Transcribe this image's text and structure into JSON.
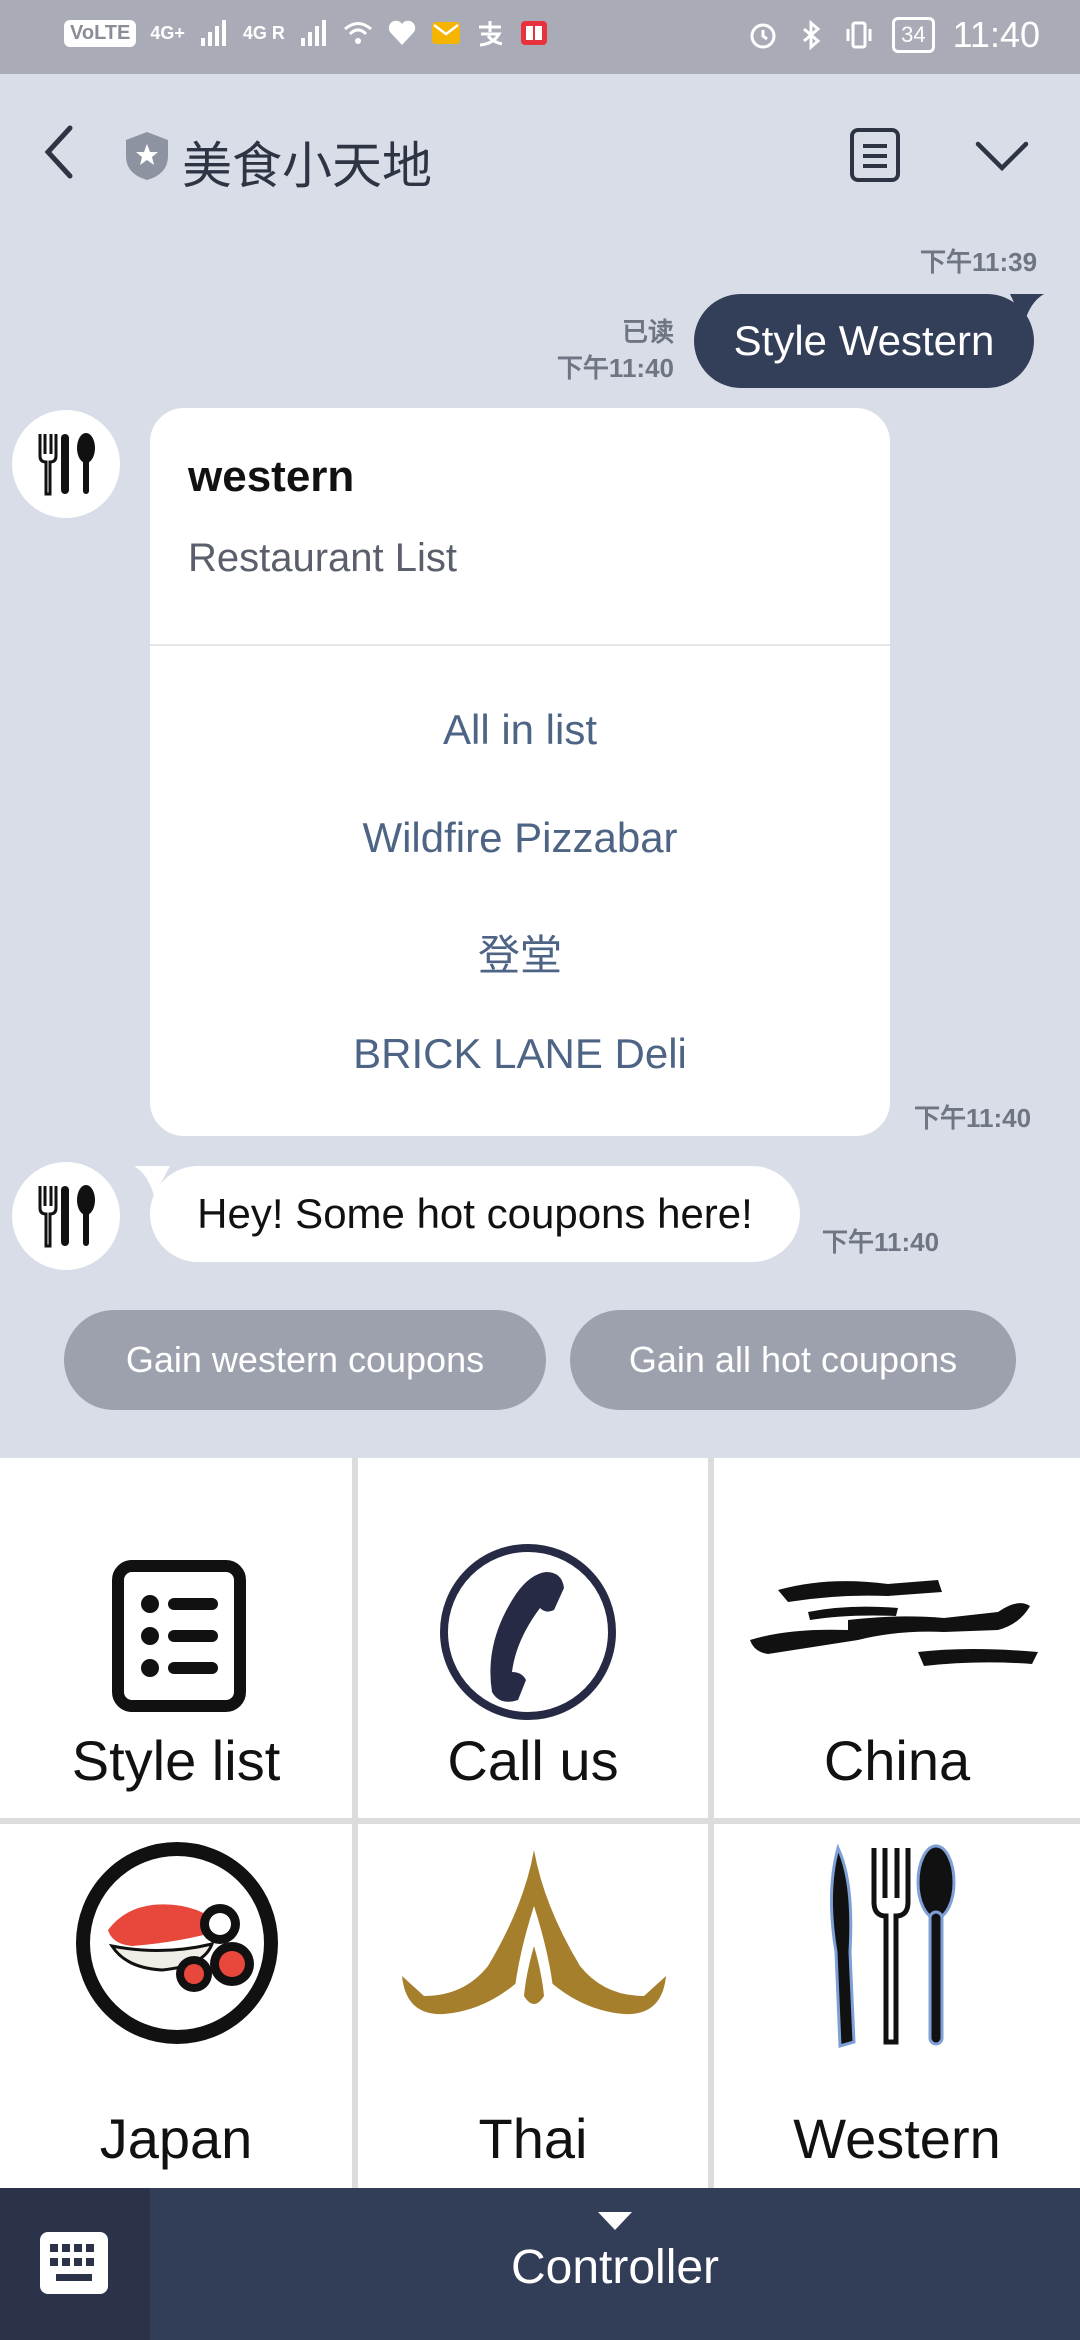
{
  "status_bar": {
    "network_badge": "VoLTE",
    "signal_1": "4G+",
    "signal_2": "4G R",
    "battery": "34",
    "time": "11:40"
  },
  "header": {
    "title": "美食小天地"
  },
  "messages": {
    "time_top": "下午11:39",
    "read_label": "已读",
    "sent_time": "下午11:40",
    "sent_text": "Style Western",
    "card": {
      "title": "western",
      "subtitle": "Restaurant List",
      "items": [
        "All in list",
        "Wildfire Pizzabar",
        "登堂",
        "BRICK LANE Deli"
      ],
      "time": "下午11:40"
    },
    "bot_text": "Hey! Some hot coupons here!",
    "bot_time": "下午11:40"
  },
  "quick_replies": [
    "Gain western coupons",
    "Gain all hot coupons"
  ],
  "rich_menu": {
    "items": [
      {
        "label": "Style list",
        "icon": "list-icon"
      },
      {
        "label": "Call us",
        "icon": "phone-icon"
      },
      {
        "label": "China",
        "icon": "china-roof-icon"
      },
      {
        "label": "Japan",
        "icon": "sushi-icon"
      },
      {
        "label": "Thai",
        "icon": "thai-temple-icon"
      },
      {
        "label": "Western",
        "icon": "cutlery-icon"
      }
    ]
  },
  "bottom_bar": {
    "controller_label": "Controller"
  }
}
